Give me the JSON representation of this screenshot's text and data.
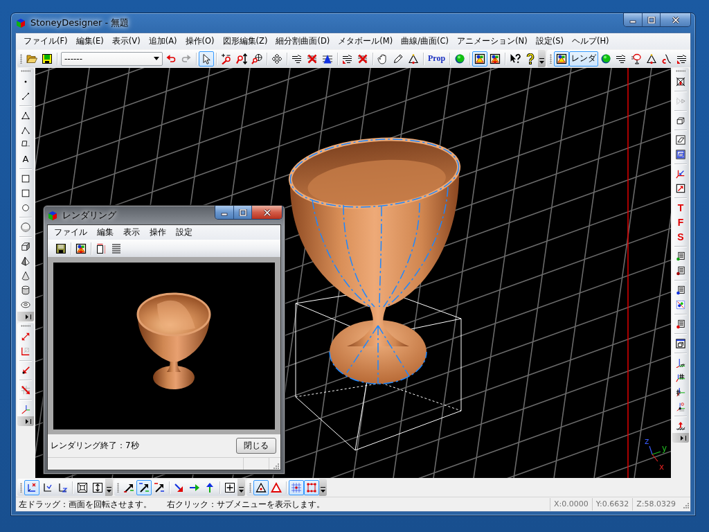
{
  "window": {
    "title": "StoneyDesigner - 無題"
  },
  "menu": [
    "ファイル(F)",
    "編集(E)",
    "表示(V)",
    "追加(A)",
    "操作(O)",
    "図形編集(Z)",
    "細分割曲面(D)",
    "メタボール(M)",
    "曲線/曲面(C)",
    "アニメーション(N)",
    "設定(S)",
    "ヘルプ(H)"
  ],
  "toolbar": {
    "combo": {
      "value": "------"
    },
    "buttons": [
      {
        "kind": "icon",
        "selected": false,
        "disabled": false
      },
      {
        "kind": "icon",
        "selected": false,
        "disabled": false
      },
      {
        "kind": "icon",
        "selected": false,
        "disabled": false
      },
      {
        "kind": "icon",
        "selected": false,
        "disabled": true
      },
      {
        "kind": "icon",
        "selected": true,
        "disabled": false
      },
      {
        "kind": "icon",
        "selected": false,
        "disabled": false
      },
      {
        "kind": "icon",
        "selected": false,
        "disabled": false
      },
      {
        "kind": "icon",
        "selected": false,
        "disabled": false
      },
      {
        "kind": "icon",
        "selected": false,
        "disabled": false
      },
      {
        "kind": "icon",
        "selected": false,
        "disabled": false
      },
      {
        "kind": "icon",
        "selected": false,
        "disabled": false
      },
      {
        "kind": "icon",
        "selected": false,
        "disabled": false
      },
      {
        "kind": "icon",
        "selected": false,
        "disabled": false
      },
      {
        "kind": "icon",
        "selected": false,
        "disabled": false
      },
      {
        "kind": "icon",
        "selected": false,
        "disabled": false
      },
      {
        "kind": "icon",
        "selected": false,
        "disabled": false
      },
      {
        "kind": "icon",
        "selected": false,
        "disabled": false
      },
      {
        "kind": "text",
        "label": "Prop",
        "selected": false,
        "disabled": false
      },
      {
        "kind": "icon",
        "selected": false,
        "disabled": false
      },
      {
        "kind": "icon",
        "selected": true,
        "disabled": false
      },
      {
        "kind": "icon",
        "selected": false,
        "disabled": false
      },
      {
        "kind": "icon",
        "selected": false,
        "disabled": false
      },
      {
        "kind": "icon",
        "selected": false,
        "disabled": false
      },
      {
        "kind": "icon",
        "selected": true,
        "disabled": false
      },
      {
        "kind": "text",
        "label": "レンダ",
        "selected": true,
        "disabled": false
      },
      {
        "kind": "icon",
        "selected": false,
        "disabled": false
      },
      {
        "kind": "icon",
        "selected": false,
        "disabled": false
      },
      {
        "kind": "icon",
        "selected": false,
        "disabled": false
      },
      {
        "kind": "icon",
        "selected": false,
        "disabled": false
      },
      {
        "kind": "icon",
        "selected": false,
        "disabled": false
      },
      {
        "kind": "icon",
        "selected": false,
        "disabled": false
      }
    ]
  },
  "left_toolbar": {
    "buttons": [
      {
        "kind": "icon"
      },
      {
        "kind": "icon"
      },
      {
        "kind": "icon"
      },
      {
        "kind": "icon"
      },
      {
        "kind": "icon"
      },
      {
        "kind": "text",
        "label": "A"
      },
      {
        "kind": "icon"
      },
      {
        "kind": "icon"
      },
      {
        "kind": "icon"
      },
      {
        "kind": "icon"
      },
      {
        "kind": "icon"
      },
      {
        "kind": "icon"
      },
      {
        "kind": "icon"
      },
      {
        "kind": "icon"
      },
      {
        "kind": "icon"
      },
      {
        "kind": "icon"
      },
      {
        "kind": "icon"
      },
      {
        "kind": "icon"
      },
      {
        "kind": "icon"
      },
      {
        "kind": "icon"
      }
    ]
  },
  "right_toolbar": {
    "buttons": [
      {
        "kind": "icon",
        "disabled": false
      },
      {
        "kind": "icon",
        "disabled": true
      },
      {
        "kind": "icon",
        "disabled": false
      },
      {
        "kind": "icon",
        "disabled": false
      },
      {
        "kind": "icon",
        "disabled": false
      },
      {
        "kind": "icon",
        "disabled": false
      },
      {
        "kind": "icon",
        "disabled": false
      },
      {
        "kind": "text",
        "label": "T",
        "disabled": false
      },
      {
        "kind": "text",
        "label": "F",
        "disabled": false
      },
      {
        "kind": "text",
        "label": "S",
        "disabled": false
      },
      {
        "kind": "icon",
        "disabled": false
      },
      {
        "kind": "icon",
        "disabled": false
      },
      {
        "kind": "icon",
        "disabled": false
      },
      {
        "kind": "icon",
        "disabled": false
      },
      {
        "kind": "icon",
        "disabled": false
      },
      {
        "kind": "icon",
        "disabled": false
      },
      {
        "kind": "icon",
        "disabled": false
      },
      {
        "kind": "icon",
        "disabled": false
      },
      {
        "kind": "icon",
        "disabled": false
      },
      {
        "kind": "icon",
        "disabled": false
      },
      {
        "kind": "icon",
        "disabled": false
      }
    ]
  },
  "viewport": {
    "axis_labels": [
      {
        "text": "z",
        "color": "#3a5cff"
      },
      {
        "text": "y",
        "color": "#22c022"
      },
      {
        "text": "x",
        "color": "#e02020"
      }
    ]
  },
  "bottom_toolbar": {
    "buttons": [
      {
        "selected": true
      },
      {
        "selected": false
      },
      {
        "selected": false
      },
      {
        "selected": false
      },
      {
        "selected": false
      },
      {
        "selected": false
      },
      {
        "selected": true
      },
      {
        "selected": false
      },
      {
        "selected": false
      },
      {
        "selected": false
      },
      {
        "selected": false
      },
      {
        "selected": false
      },
      {
        "selected": true
      },
      {
        "selected": false
      },
      {
        "selected": true
      },
      {
        "selected": true
      }
    ]
  },
  "status_bar": {
    "hints": [
      "左ドラッグ：画面を回転させます。",
      "右クリック：サブメニューを表示します。"
    ],
    "coords": [
      "X:0.0000",
      "Y:0.6632",
      "Z:58.0329"
    ]
  },
  "dialog": {
    "title": "レンダリング",
    "menu": [
      "ファイル",
      "編集",
      "表示",
      "操作",
      "設定"
    ],
    "message": "レンダリング終了：7秒",
    "close_button": "閉じる"
  }
}
